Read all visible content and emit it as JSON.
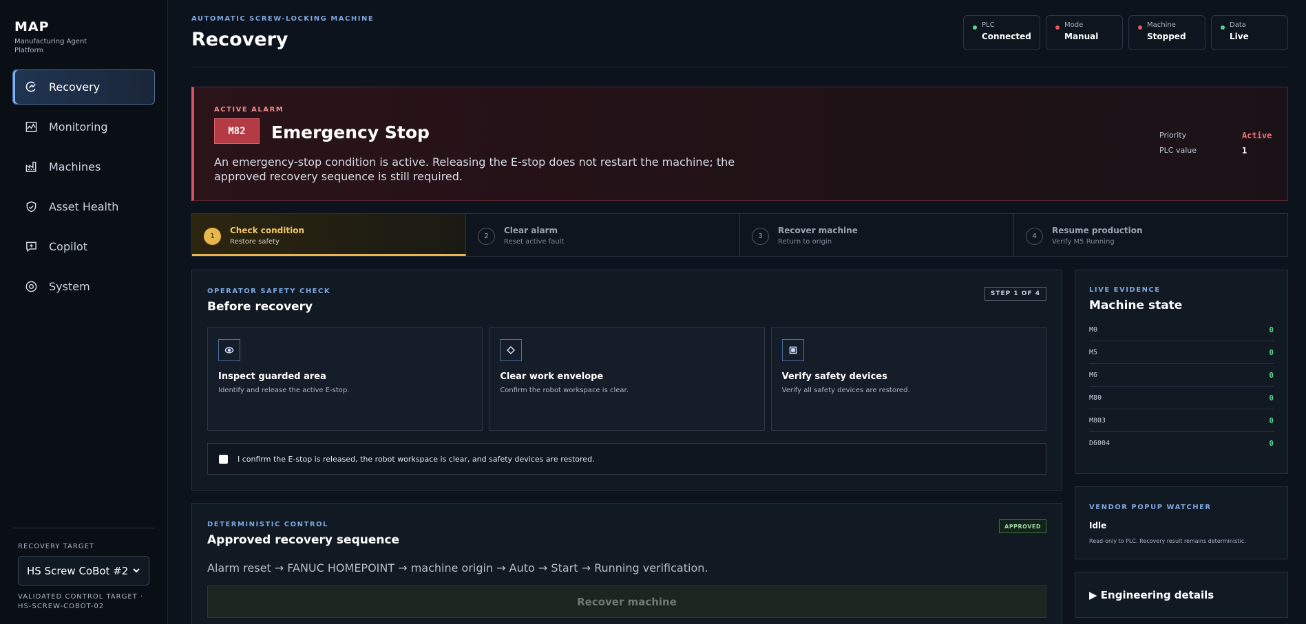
{
  "brand": {
    "title": "MAP",
    "subtitle": "Manufacturing Agent Platform"
  },
  "nav": [
    {
      "label": "Recovery",
      "icon": "recovery-icon",
      "active": true
    },
    {
      "label": "Monitoring",
      "icon": "monitoring-icon",
      "active": false
    },
    {
      "label": "Machines",
      "icon": "factory-icon",
      "active": false
    },
    {
      "label": "Asset Health",
      "icon": "shield-icon",
      "active": false
    },
    {
      "label": "Copilot",
      "icon": "chat-icon",
      "active": false
    },
    {
      "label": "System",
      "icon": "gear-icon",
      "active": false
    }
  ],
  "recovery_target": {
    "label": "RECOVERY TARGET",
    "selected": "HS Screw CoBot #2",
    "footer": "VALIDATED CONTROL TARGET · HS-SCREW-COBOT-02"
  },
  "header": {
    "eyebrow": "AUTOMATIC SCREW-LOCKING MACHINE",
    "title": "Recovery"
  },
  "status": [
    {
      "label": "PLC",
      "value": "Connected",
      "color": "#5fd48b"
    },
    {
      "label": "Mode",
      "value": "Manual",
      "color": "#e35a64"
    },
    {
      "label": "Machine",
      "value": "Stopped",
      "color": "#e35a64"
    },
    {
      "label": "Data",
      "value": "Live",
      "color": "#5fd48b"
    }
  ],
  "alarm": {
    "eyebrow": "ACTIVE ALARM",
    "code": "M82",
    "title": "Emergency Stop",
    "description": "An emergency-stop condition is active. Releasing the E-stop does not restart the machine; the approved recovery sequence is still required.",
    "priority_label": "Priority",
    "priority_value": "Active",
    "plc_label": "PLC value",
    "plc_value": "1",
    "color": "#d8535f"
  },
  "steps": [
    {
      "num": "1",
      "title": "Check condition",
      "sub": "Restore safety",
      "active": true
    },
    {
      "num": "2",
      "title": "Clear alarm",
      "sub": "Reset active fault",
      "active": false
    },
    {
      "num": "3",
      "title": "Recover machine",
      "sub": "Return to origin",
      "active": false
    },
    {
      "num": "4",
      "title": "Resume production",
      "sub": "Verify M5 Running",
      "active": false
    }
  ],
  "safety": {
    "eyebrow": "OPERATOR SAFETY CHECK",
    "title": "Before recovery",
    "badge": "STEP 1 OF 4",
    "cards": [
      {
        "icon": "eye-icon",
        "title": "Inspect guarded area",
        "desc": "Identify and release the active E-stop."
      },
      {
        "icon": "diamond-icon",
        "title": "Clear work envelope",
        "desc": "Confirm the robot workspace is clear."
      },
      {
        "icon": "square-icon",
        "title": "Verify safety devices",
        "desc": "Verify all safety devices are restored."
      }
    ],
    "confirm": "I confirm the E-stop is released, the robot workspace is clear, and safety devices are restored."
  },
  "sequence": {
    "eyebrow": "DETERMINISTIC CONTROL",
    "title": "Approved recovery sequence",
    "badge": "APPROVED",
    "desc": "Alarm reset → FANUC HOMEPOINT → machine origin → Auto → Start → Running verification.",
    "button": "Recover machine"
  },
  "evidence": {
    "eyebrow": "LIVE EVIDENCE",
    "title": "Machine state",
    "rows": [
      {
        "key": "M0",
        "value": "0"
      },
      {
        "key": "M5",
        "value": "0"
      },
      {
        "key": "M6",
        "value": "0"
      },
      {
        "key": "M80",
        "value": "0"
      },
      {
        "key": "M803",
        "value": "0"
      },
      {
        "key": "D6004",
        "value": "0"
      }
    ]
  },
  "vendor": {
    "eyebrow": "VENDOR POPUP WATCHER",
    "title": "Idle",
    "desc": "Read-only to PLC. Recovery result remains deterministic."
  },
  "engineering": {
    "title": "Engineering details"
  }
}
